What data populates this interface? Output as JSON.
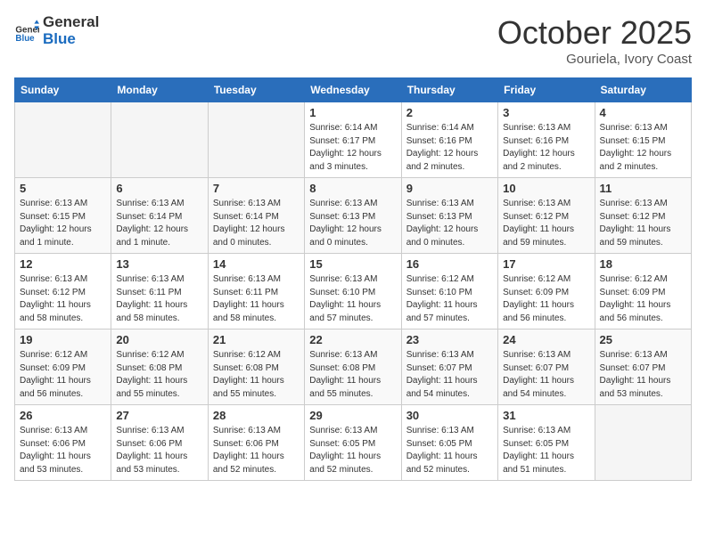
{
  "header": {
    "logo_general": "General",
    "logo_blue": "Blue",
    "month": "October 2025",
    "location": "Gouriela, Ivory Coast"
  },
  "weekdays": [
    "Sunday",
    "Monday",
    "Tuesday",
    "Wednesday",
    "Thursday",
    "Friday",
    "Saturday"
  ],
  "weeks": [
    [
      {
        "day": "",
        "info": ""
      },
      {
        "day": "",
        "info": ""
      },
      {
        "day": "",
        "info": ""
      },
      {
        "day": "1",
        "info": "Sunrise: 6:14 AM\nSunset: 6:17 PM\nDaylight: 12 hours and 3 minutes."
      },
      {
        "day": "2",
        "info": "Sunrise: 6:14 AM\nSunset: 6:16 PM\nDaylight: 12 hours and 2 minutes."
      },
      {
        "day": "3",
        "info": "Sunrise: 6:13 AM\nSunset: 6:16 PM\nDaylight: 12 hours and 2 minutes."
      },
      {
        "day": "4",
        "info": "Sunrise: 6:13 AM\nSunset: 6:15 PM\nDaylight: 12 hours and 2 minutes."
      }
    ],
    [
      {
        "day": "5",
        "info": "Sunrise: 6:13 AM\nSunset: 6:15 PM\nDaylight: 12 hours and 1 minute."
      },
      {
        "day": "6",
        "info": "Sunrise: 6:13 AM\nSunset: 6:14 PM\nDaylight: 12 hours and 1 minute."
      },
      {
        "day": "7",
        "info": "Sunrise: 6:13 AM\nSunset: 6:14 PM\nDaylight: 12 hours and 0 minutes."
      },
      {
        "day": "8",
        "info": "Sunrise: 6:13 AM\nSunset: 6:13 PM\nDaylight: 12 hours and 0 minutes."
      },
      {
        "day": "9",
        "info": "Sunrise: 6:13 AM\nSunset: 6:13 PM\nDaylight: 12 hours and 0 minutes."
      },
      {
        "day": "10",
        "info": "Sunrise: 6:13 AM\nSunset: 6:12 PM\nDaylight: 11 hours and 59 minutes."
      },
      {
        "day": "11",
        "info": "Sunrise: 6:13 AM\nSunset: 6:12 PM\nDaylight: 11 hours and 59 minutes."
      }
    ],
    [
      {
        "day": "12",
        "info": "Sunrise: 6:13 AM\nSunset: 6:12 PM\nDaylight: 11 hours and 58 minutes."
      },
      {
        "day": "13",
        "info": "Sunrise: 6:13 AM\nSunset: 6:11 PM\nDaylight: 11 hours and 58 minutes."
      },
      {
        "day": "14",
        "info": "Sunrise: 6:13 AM\nSunset: 6:11 PM\nDaylight: 11 hours and 58 minutes."
      },
      {
        "day": "15",
        "info": "Sunrise: 6:13 AM\nSunset: 6:10 PM\nDaylight: 11 hours and 57 minutes."
      },
      {
        "day": "16",
        "info": "Sunrise: 6:12 AM\nSunset: 6:10 PM\nDaylight: 11 hours and 57 minutes."
      },
      {
        "day": "17",
        "info": "Sunrise: 6:12 AM\nSunset: 6:09 PM\nDaylight: 11 hours and 56 minutes."
      },
      {
        "day": "18",
        "info": "Sunrise: 6:12 AM\nSunset: 6:09 PM\nDaylight: 11 hours and 56 minutes."
      }
    ],
    [
      {
        "day": "19",
        "info": "Sunrise: 6:12 AM\nSunset: 6:09 PM\nDaylight: 11 hours and 56 minutes."
      },
      {
        "day": "20",
        "info": "Sunrise: 6:12 AM\nSunset: 6:08 PM\nDaylight: 11 hours and 55 minutes."
      },
      {
        "day": "21",
        "info": "Sunrise: 6:12 AM\nSunset: 6:08 PM\nDaylight: 11 hours and 55 minutes."
      },
      {
        "day": "22",
        "info": "Sunrise: 6:13 AM\nSunset: 6:08 PM\nDaylight: 11 hours and 55 minutes."
      },
      {
        "day": "23",
        "info": "Sunrise: 6:13 AM\nSunset: 6:07 PM\nDaylight: 11 hours and 54 minutes."
      },
      {
        "day": "24",
        "info": "Sunrise: 6:13 AM\nSunset: 6:07 PM\nDaylight: 11 hours and 54 minutes."
      },
      {
        "day": "25",
        "info": "Sunrise: 6:13 AM\nSunset: 6:07 PM\nDaylight: 11 hours and 53 minutes."
      }
    ],
    [
      {
        "day": "26",
        "info": "Sunrise: 6:13 AM\nSunset: 6:06 PM\nDaylight: 11 hours and 53 minutes."
      },
      {
        "day": "27",
        "info": "Sunrise: 6:13 AM\nSunset: 6:06 PM\nDaylight: 11 hours and 53 minutes."
      },
      {
        "day": "28",
        "info": "Sunrise: 6:13 AM\nSunset: 6:06 PM\nDaylight: 11 hours and 52 minutes."
      },
      {
        "day": "29",
        "info": "Sunrise: 6:13 AM\nSunset: 6:05 PM\nDaylight: 11 hours and 52 minutes."
      },
      {
        "day": "30",
        "info": "Sunrise: 6:13 AM\nSunset: 6:05 PM\nDaylight: 11 hours and 52 minutes."
      },
      {
        "day": "31",
        "info": "Sunrise: 6:13 AM\nSunset: 6:05 PM\nDaylight: 11 hours and 51 minutes."
      },
      {
        "day": "",
        "info": ""
      }
    ]
  ]
}
